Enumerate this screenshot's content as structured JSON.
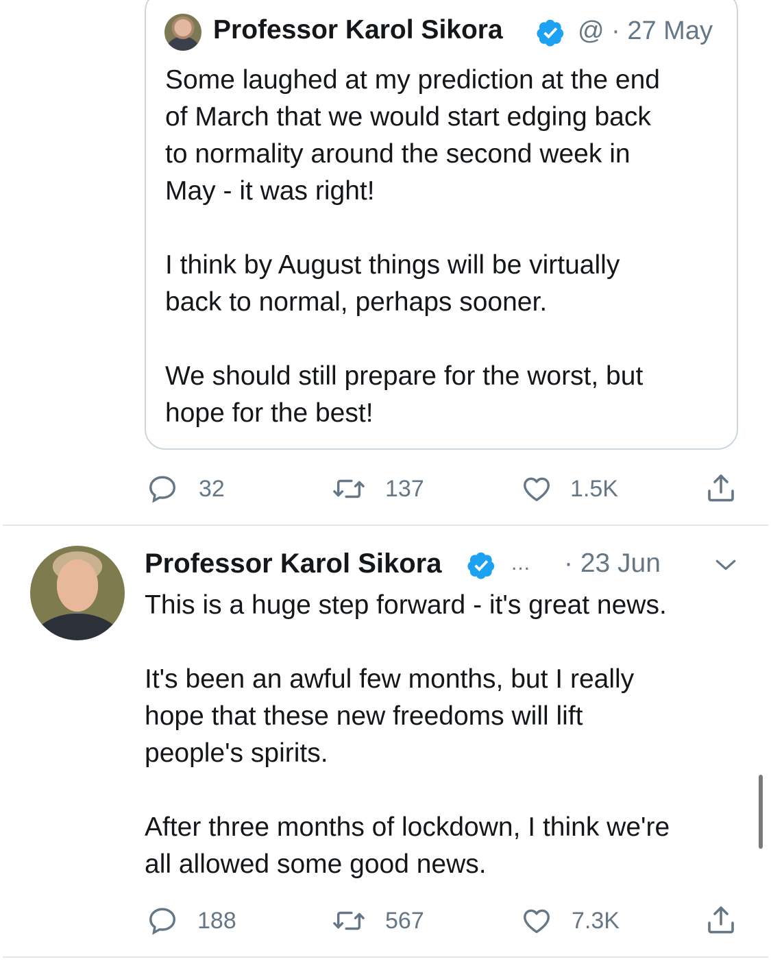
{
  "quoted_tweet": {
    "author_name": "Professor Karol Sikora",
    "handle": "@",
    "date": "· 27 May",
    "text": "Some laughed at my prediction at the end\nof March that we would start edging back\nto normality around the second week in\nMay - it was right!\n\nI think by August things will be virtually\nback to normal, perhaps sooner.\n\nWe should still prepare for the worst, but\nhope for the best!",
    "reply_count": "32",
    "retweet_count": "137",
    "like_count": "1.5K"
  },
  "tweet": {
    "author_name": "Professor Karol Sikora",
    "more": "...",
    "date": "· 23 Jun",
    "text": "This is a huge step forward - it's great news.\n\nIt's been an awful few months, but I really\nhope that these new freedoms will lift\npeople's spirits.\n\nAfter three months of lockdown, I think we're\nall allowed some good news.",
    "reply_count": "188",
    "retweet_count": "567",
    "like_count": "7.3K"
  },
  "colors": {
    "verified_blue": "#1da1f2",
    "secondary_text": "#657786",
    "divider": "#e1e8ed"
  },
  "icons": [
    "reply-icon",
    "retweet-icon",
    "like-icon",
    "share-icon",
    "verified-icon",
    "chevron-down-icon"
  ]
}
